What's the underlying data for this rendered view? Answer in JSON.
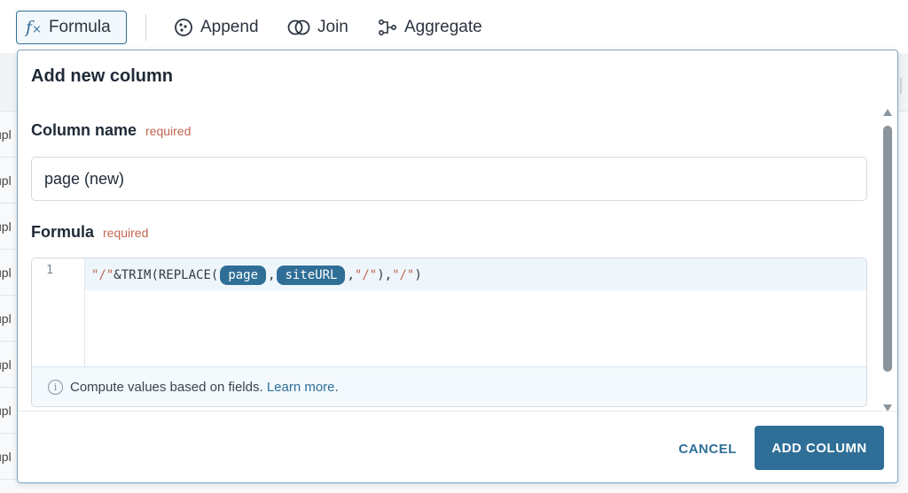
{
  "toolbar": {
    "formula_label": "Formula",
    "append_label": "Append",
    "join_label": "Join",
    "aggregate_label": "Aggregate"
  },
  "background": {
    "row_text": "upl"
  },
  "modal": {
    "title": "Add new column",
    "column_name": {
      "label": "Column name",
      "required": "required",
      "value": "page (new)"
    },
    "formula": {
      "label": "Formula",
      "required": "required",
      "line_number": "1",
      "tokens": {
        "t1": "\"/\"",
        "t2": "&TRIM(REPLACE(",
        "field1": "page",
        "t3": ",",
        "field2": "siteURL",
        "t4": ",",
        "t5": "\"/\"",
        "t6": "),",
        "t7": "\"/\"",
        "t8": ")"
      },
      "hint_text": "Compute values based on fields.",
      "hint_link": "Learn more",
      "hint_end": "."
    },
    "cancel_label": "CANCEL",
    "add_label": "ADD COLUMN"
  },
  "colors": {
    "accent": "#2f6f97",
    "required": "#c0664f",
    "hint_bg": "#f3f9fc"
  }
}
